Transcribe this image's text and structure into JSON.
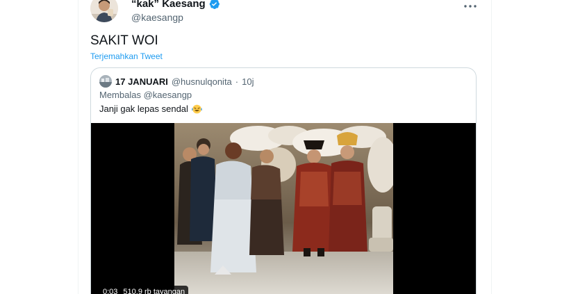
{
  "tweet": {
    "display_name": "“kak” Kaesang",
    "handle": "@kaesangp",
    "text": "SAKIT WOI",
    "translate_label": "Terjemahkan Tweet",
    "more_icon": "more-horizontal-icon"
  },
  "quote": {
    "display_name": "17 JANUARI",
    "handle": "@husnulqonita",
    "separator": "·",
    "time": "10j",
    "reply_text": "Membalas @kaesangp",
    "text": "Janji gak lepas sendal",
    "emoji": "laughing-crying-emoji",
    "media": {
      "elapsed": "0:03",
      "views": "510,9 rb tayangan"
    }
  },
  "colors": {
    "accent": "#1d9bf0",
    "text_primary": "#0f1419",
    "text_secondary": "#536471",
    "border": "#cfd9de"
  }
}
